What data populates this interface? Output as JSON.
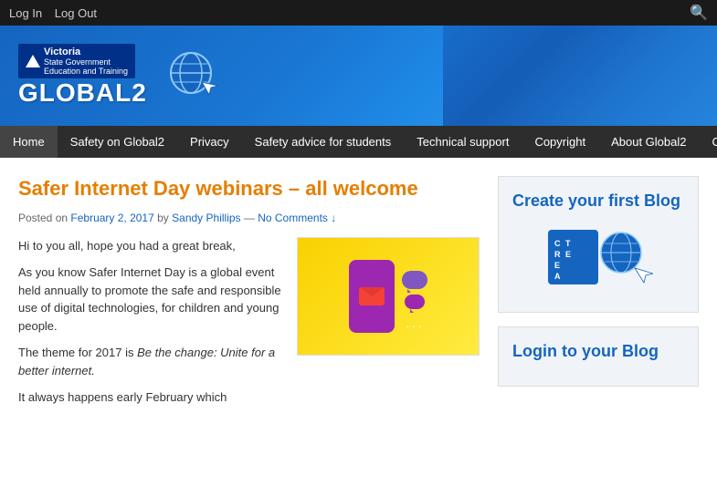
{
  "topbar": {
    "login_label": "Log In",
    "logout_label": "Log Out",
    "search_tooltip": "Search"
  },
  "header": {
    "vic_gov_line1": "Victoria",
    "vic_gov_line2": "State Government",
    "vic_gov_sub": "Education and Training",
    "site_name": "GLOBAL2",
    "alt": "Victoria State Government Education and Training - Global2"
  },
  "nav": {
    "items": [
      {
        "label": "Home",
        "active": true
      },
      {
        "label": "Safety on Global2",
        "active": false
      },
      {
        "label": "Privacy",
        "active": false
      },
      {
        "label": "Safety advice for students",
        "active": false
      },
      {
        "label": "Technical support",
        "active": false
      },
      {
        "label": "Copyright",
        "active": false
      },
      {
        "label": "About Global2",
        "active": false
      },
      {
        "label": "Contact us",
        "active": false
      }
    ]
  },
  "article": {
    "title": "Safer Internet Day webinars – all welcome",
    "meta_posted": "Posted on",
    "meta_date": "February 2, 2017",
    "meta_by": "by",
    "meta_author": "Sandy Phillips",
    "meta_separator": "—",
    "meta_comments": "No Comments",
    "meta_comments_arrow": "↓",
    "para1": "Hi to you all, hope you had a great break,",
    "para2": "As you know Safer Internet Day is a global event held annually to promote the safe and responsible use of digital technologies, for children and young people.",
    "para3": "The theme for 2017 is",
    "para3_italic": "Be the change: Unite for a better internet.",
    "para4": "It always happens early February which"
  },
  "sidebar": {
    "create_blog_title": "Create your first Blog",
    "login_blog_title": "Login to your Blog"
  }
}
